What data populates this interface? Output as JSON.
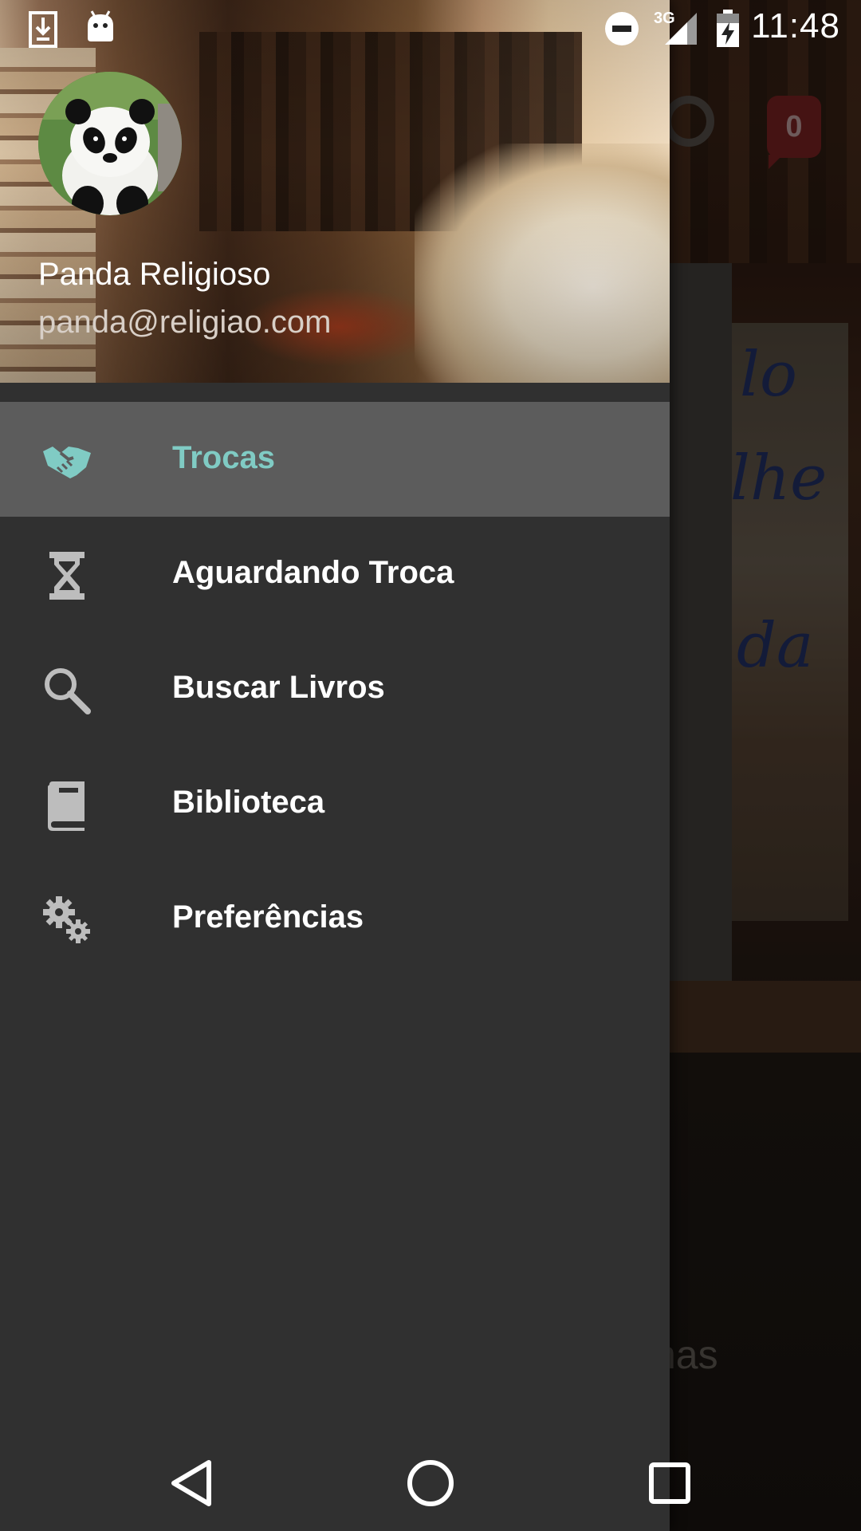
{
  "status_bar": {
    "time": "11:48",
    "network": "3G",
    "icons": [
      "download-icon",
      "android-icon",
      "do-not-disturb-icon",
      "signal-icon",
      "battery-charging-icon"
    ]
  },
  "background": {
    "badge_count": "0",
    "partial_text": "nas"
  },
  "drawer": {
    "user": {
      "name": "Panda Religioso",
      "email": "panda@religiao.com"
    },
    "items": [
      {
        "label": "Trocas",
        "icon": "handshake-icon",
        "active": true
      },
      {
        "label": "Aguardando Troca",
        "icon": "hourglass-icon",
        "active": false
      },
      {
        "label": "Buscar Livros",
        "icon": "search-icon",
        "active": false
      },
      {
        "label": "Biblioteca",
        "icon": "book-icon",
        "active": false
      },
      {
        "label": "Preferências",
        "icon": "gears-icon",
        "active": false
      }
    ]
  },
  "colors": {
    "accent": "#80cbc4",
    "drawer_bg": "#303030",
    "active_item_bg": "#5c5c5c"
  },
  "system_nav": [
    "back-button",
    "home-button",
    "recents-button"
  ]
}
